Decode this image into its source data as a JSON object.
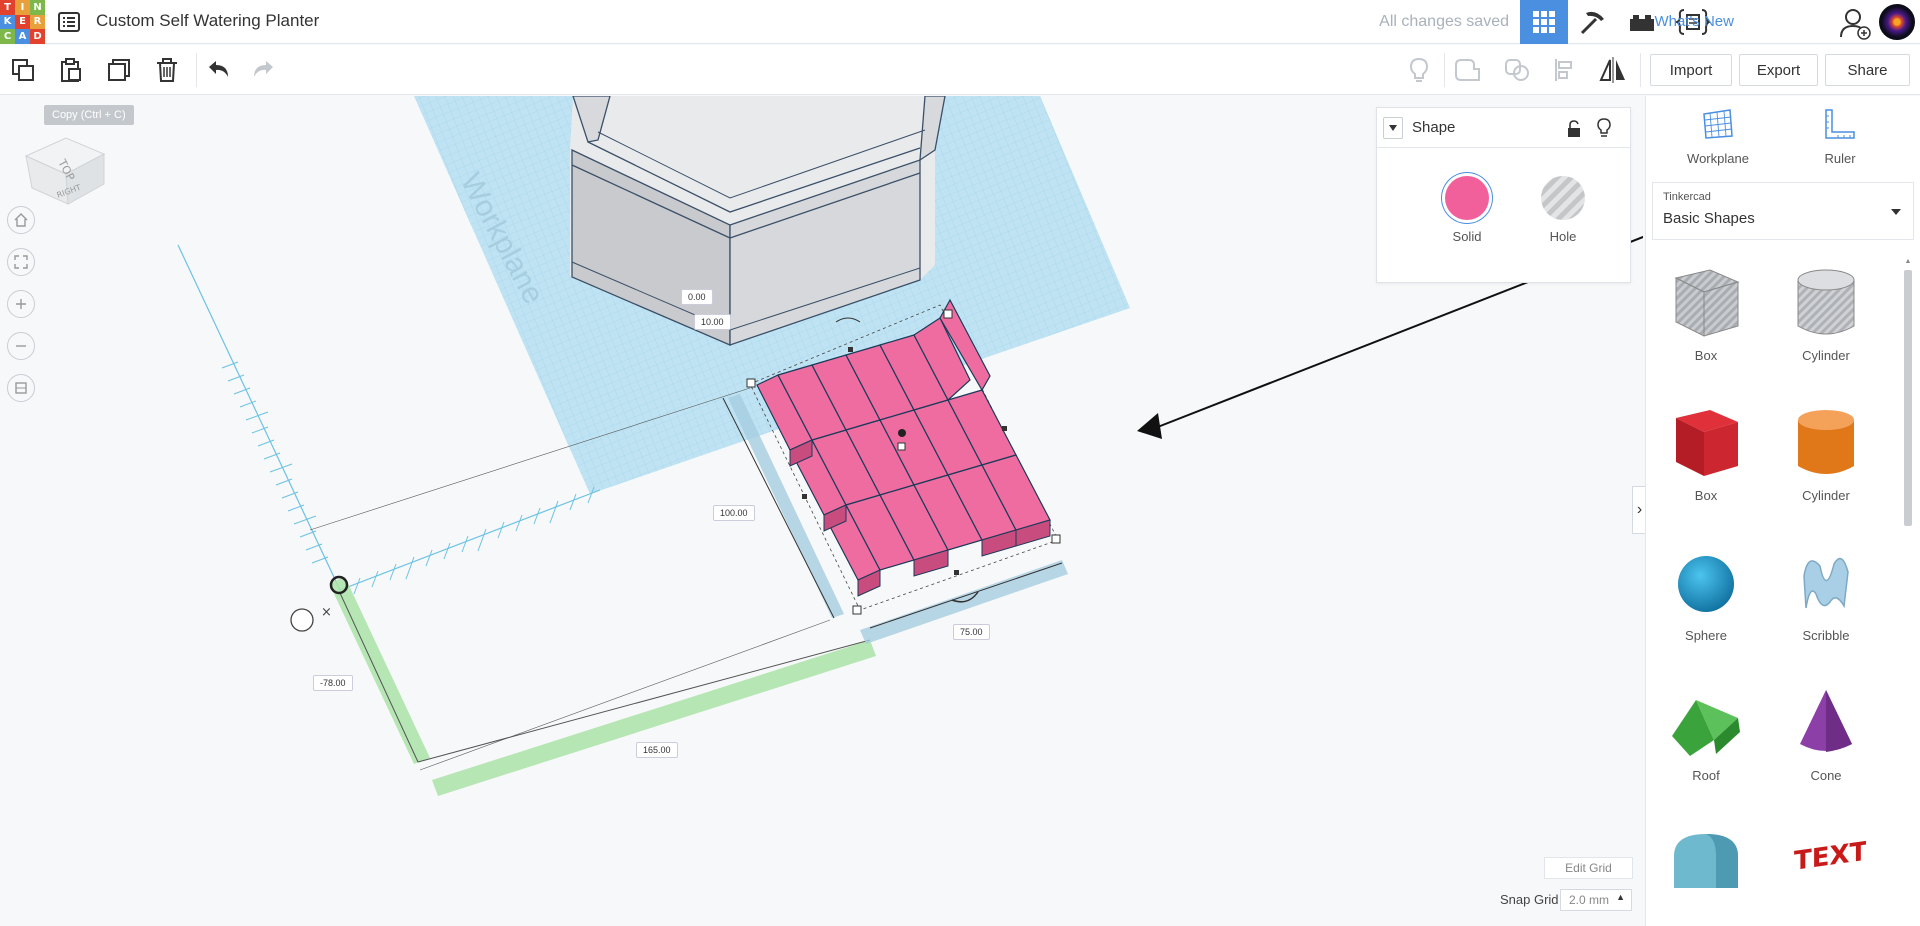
{
  "app": {
    "logo_letters": [
      "T",
      "I",
      "N",
      "K",
      "E",
      "R",
      "C",
      "A",
      "D"
    ],
    "logo_colors": [
      "#e2412d",
      "#e9a03b",
      "#7fb84a",
      "#4a8fe0",
      "#e2412d",
      "#e9a03b",
      "#7fb84a",
      "#4a8fe0",
      "#e2412d"
    ],
    "design_title": "Custom Self Watering Planter",
    "save_status": "All changes saved",
    "whats_new": "What's New",
    "accent_color": "#4a8fe0"
  },
  "header_views": [
    {
      "name": "3d-design-view",
      "icon": "grid-icon",
      "active": true
    },
    {
      "name": "minecraft-view",
      "icon": "pickaxe-icon",
      "active": false
    },
    {
      "name": "bricks-view",
      "icon": "brick-icon",
      "active": false
    },
    {
      "name": "codeblocks-view",
      "icon": "code-blocks-icon",
      "active": false
    }
  ],
  "toolbar": {
    "tools": [
      {
        "name": "copy",
        "icon": "copy-icon"
      },
      {
        "name": "paste",
        "icon": "paste-icon"
      },
      {
        "name": "duplicate",
        "icon": "duplicate-icon"
      },
      {
        "name": "delete",
        "icon": "trash-icon"
      },
      {
        "name": "undo",
        "icon": "undo-icon"
      },
      {
        "name": "redo",
        "icon": "redo-icon"
      }
    ],
    "right_tools": [
      "lightbulb-icon",
      "group-icon",
      "ungroup-icon",
      "align-icon",
      "mirror-icon"
    ],
    "import_label": "Import",
    "export_label": "Export",
    "share_label": "Share",
    "tooltip": "Copy (Ctrl + C)"
  },
  "viewcube": {
    "top": "TOP",
    "right": "RIGHT"
  },
  "workplane_text": "Workplane",
  "shape_panel": {
    "title": "Shape",
    "solid_label": "Solid",
    "hole_label": "Hole",
    "solid_color": "#f2609b"
  },
  "dimensions": {
    "elevation": "0.00",
    "height": "10.00",
    "length": "100.00",
    "width": "75.00",
    "x_offset": "-78.00",
    "y_offset": "165.00"
  },
  "grid": {
    "edit_grid": "Edit Grid",
    "snap_label": "Snap Grid",
    "snap_value": "2.0 mm"
  },
  "right_panel": {
    "workplane_label": "Workplane",
    "ruler_label": "Ruler",
    "library_provider": "Tinkercad",
    "library_name": "Basic Shapes",
    "shapes": [
      {
        "label": "Box",
        "icon": "box-hole-icon"
      },
      {
        "label": "Cylinder",
        "icon": "cylinder-hole-icon"
      },
      {
        "label": "Box",
        "icon": "box-icon"
      },
      {
        "label": "Cylinder",
        "icon": "cylinder-icon"
      },
      {
        "label": "Sphere",
        "icon": "sphere-icon"
      },
      {
        "label": "Scribble",
        "icon": "scribble-icon"
      },
      {
        "label": "Roof",
        "icon": "roof-icon"
      },
      {
        "label": "Cone",
        "icon": "cone-icon"
      },
      {
        "label": "",
        "icon": "round-roof-icon"
      },
      {
        "label": "",
        "icon": "text-icon"
      }
    ]
  }
}
